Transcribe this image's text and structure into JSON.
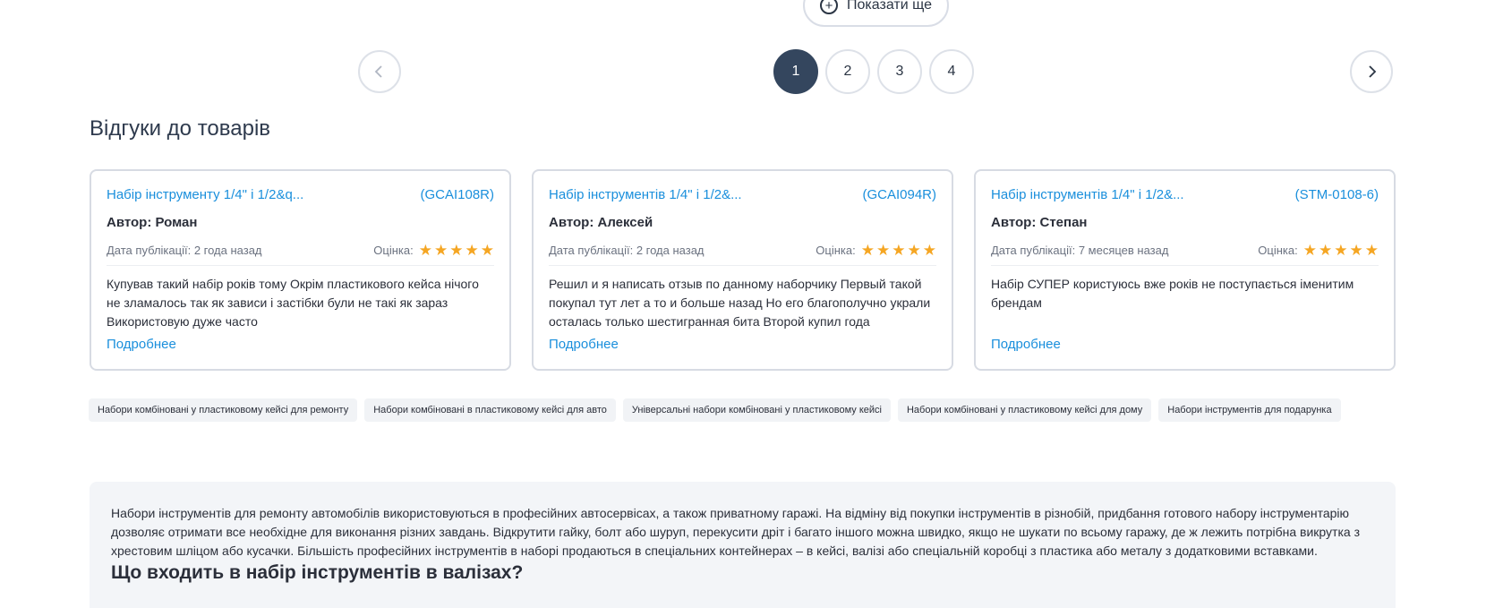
{
  "show_more": {
    "label": "Показати ще"
  },
  "pagination": {
    "pages": [
      "1",
      "2",
      "3",
      "4"
    ],
    "current": "1"
  },
  "reviews_section": {
    "title": "Відгуки до товарів",
    "date_label": "Дата публікації:",
    "rating_label": "Оцінка:",
    "more_label": "Подробнее",
    "items": [
      {
        "product": "Набір інструменту 1/4\" і 1/2&q...",
        "sku": "(GCAI108R)",
        "author": "Автор: Роман",
        "date": "2 года назад",
        "rating": 5,
        "text": "Купував такий набір років тому Окрім пластикового кейса нічого не зламалось так як зависи і застібки були не такі як зараз Використовую дуже часто"
      },
      {
        "product": "Набір інструментів 1/4\" і 1/2&...",
        "sku": "(GCAI094R)",
        "author": "Автор: Алексей",
        "date": "2 года назад",
        "rating": 5,
        "text": "Решил и я написать отзыв по данному наборчику Первый такой покупал тут лет а то и больше назад Но его благополучно украли осталась только шестигранная бита Второй купил года"
      },
      {
        "product": "Набір інструментів 1/4\" і 1/2&...",
        "sku": "(STM-0108-6)",
        "author": "Автор: Степан",
        "date": "7 месяцев назад",
        "rating": 5,
        "text": "Набір СУПЕР користуюсь вже років не поступається іменитим брендам"
      }
    ]
  },
  "tags": [
    "Набори комбіновані у пластиковому кейсі для ремонту",
    "Набори комбіновані в пластиковому кейсі для авто",
    "Універсальні набори комбіновані у пластиковому кейсі",
    "Набори комбіновані у пластиковому кейсі для дому",
    "Набори інструментів для подарунка"
  ],
  "info": {
    "text": "Набори інструментів для ремонту автомобілів використовуються в професійних автосервісах, а також приватному гаражі. На відміну від покупки інструментів в різнобій, придбання готового   набору інструментарію дозволяє отримати все необхідне для виконання різних завдань. Відкрутити гайку, болт або шуруп, перекусити дріт і багато іншого можна швидко, якщо не шукати по всьому гаражу, де ж лежить потрібна викрутка з хрестовим шліцом або кусачки. Більшість професійних інструментів в наборі продаються в спеціальних контейнерах –   в кейсі, валізі або спеціальній коробці з пластика або металу з додатковими вставками.",
    "heading": "Що входить в набір інструментів в валізах?"
  },
  "colors": {
    "accent": "#1a8fdc",
    "active_page": "#34465e",
    "star": "#f5a623"
  }
}
